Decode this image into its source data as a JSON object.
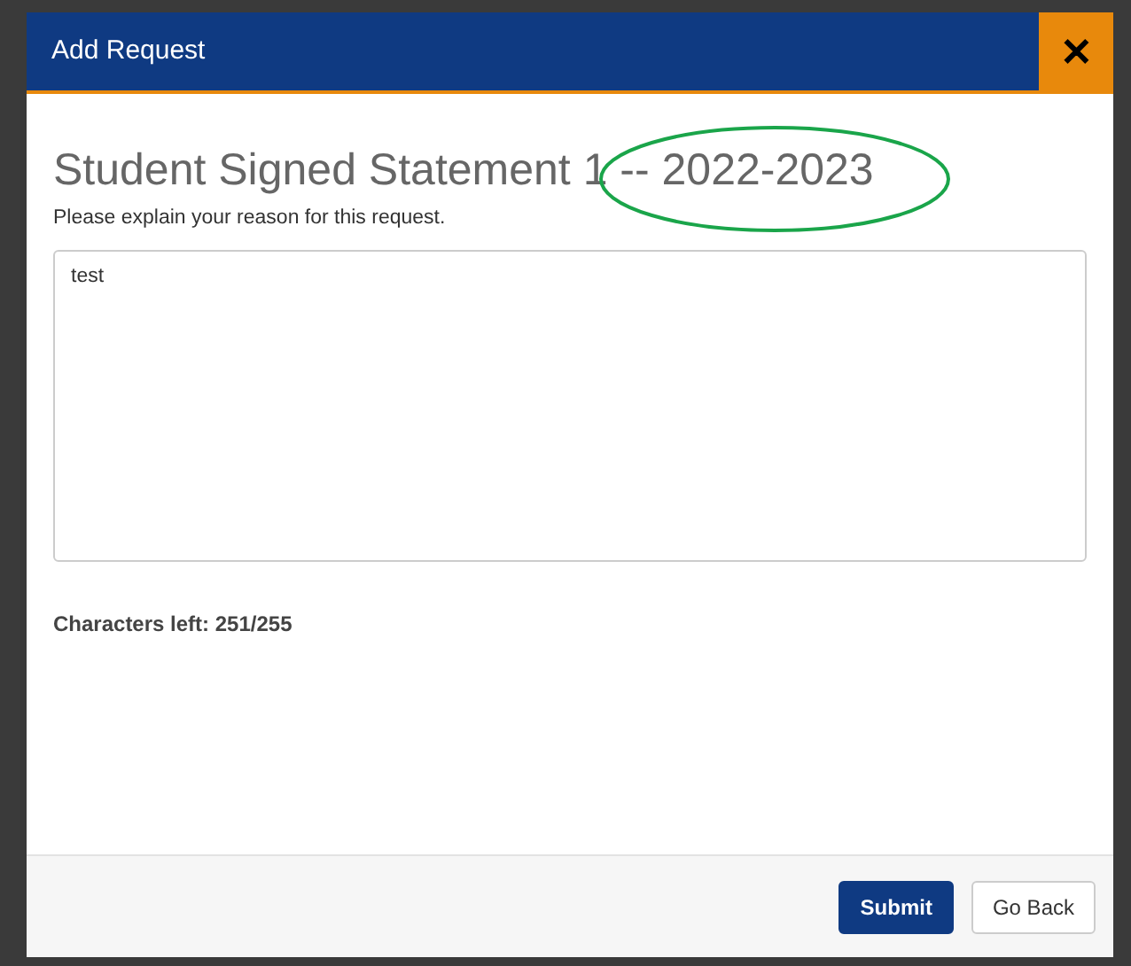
{
  "dialog": {
    "title": "Add Request",
    "close": "✕"
  },
  "heading": "Student Signed Statement 1 -- 2022-2023",
  "prompt": "Please explain your reason for this request.",
  "reason": {
    "value": "test"
  },
  "counter": "Characters left: 251/255",
  "buttons": [
    {
      "label": "Submit",
      "kind": "primary"
    },
    {
      "label": "Go Back",
      "kind": "secondary"
    }
  ],
  "annotation": {
    "kind": "ellipse",
    "color": "#1aa54a"
  }
}
